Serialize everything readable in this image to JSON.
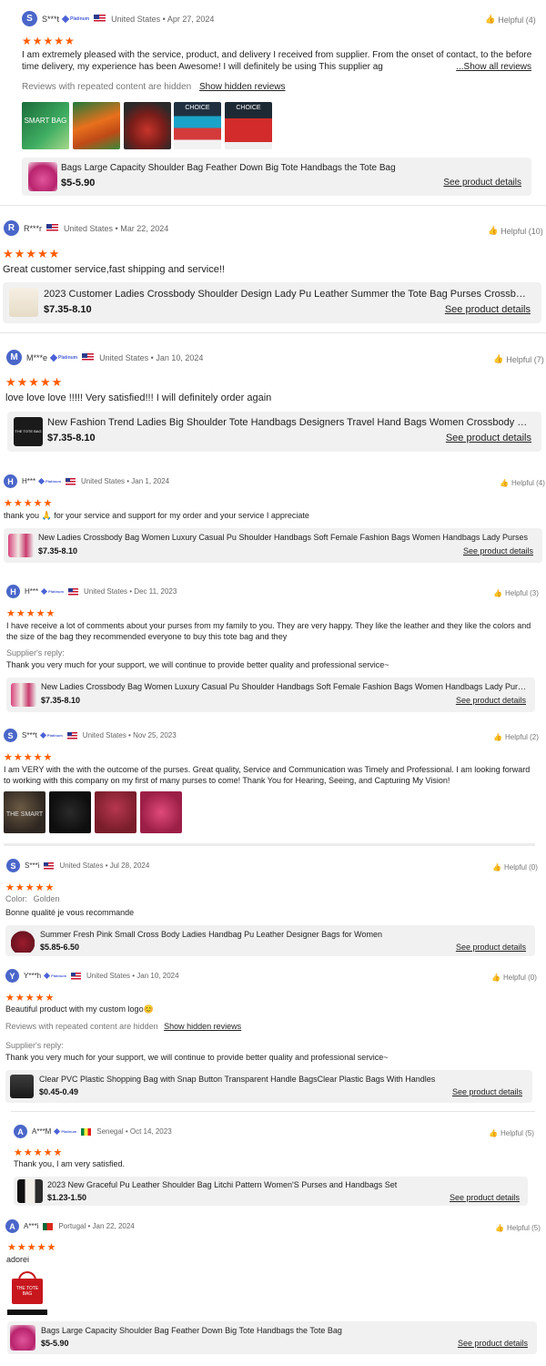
{
  "common": {
    "see_details": "See product details",
    "badge": "Platinum",
    "star_glyphs": "★★★★★",
    "suppliers_reply_label": "Supplier's reply:",
    "hidden_note": "Reviews with repeated content are hidden",
    "show_hidden": "Show hidden reviews",
    "show_all": "...Show all reviews"
  },
  "reviews": [
    {
      "initial": "S",
      "name": "S***t",
      "platinum": true,
      "flag": "us",
      "meta": "United States • Apr 27, 2024",
      "helpful": "Helpful (4)",
      "rating": 5,
      "text": "I am extremely pleased with the service, product, and delivery I received from supplier. From the onset of contact, to the before time delivery, my experience has been Awesome! I will definitely be using This supplier ag",
      "product": {
        "title": "Bags Large Capacity Shoulder Bag Feather Down Big Tote Handbags the Tote Bag",
        "price": "$5-5.90"
      }
    },
    {
      "initial": "R",
      "name": "R***r",
      "platinum": false,
      "flag": "us",
      "meta": "United States • Mar 22, 2024",
      "helpful": "Helpful (10)",
      "rating": 5,
      "text": "Great customer service,fast shipping and service!!",
      "product": {
        "title": "2023 Customer Ladies Crossbody Shoulder Design Lady Pu Leather Summer the Tote Bag Purses Crossbody Bag",
        "price": "$7.35-8.10"
      }
    },
    {
      "initial": "M",
      "name": "M***e",
      "platinum": true,
      "flag": "us",
      "meta": "United States • Jan 10, 2024",
      "helpful": "Helpful (7)",
      "rating": 5,
      "text": "love love love !!!!! Very satisfied!!! I will definitely order again",
      "product": {
        "title": "New Fashion Trend Ladies Big Shoulder Tote Handbags Designers Travel Hand Bags Women Crossbody Bags",
        "price": "$7.35-8.10"
      }
    },
    {
      "initial": "H",
      "name": "H***",
      "platinum": true,
      "flag": "us",
      "meta": "United States • Jan 1, 2024",
      "helpful": "Helpful (4)",
      "rating": 5,
      "text": "thank you 🙏 for your service and support for my order and your service I appreciate",
      "product": {
        "title": "New Ladies Crossbody Bag Women Luxury Casual Pu Shoulder Handbags Soft Female Fashion Bags Women Handbags Lady Purses",
        "price": "$7.35-8.10"
      }
    },
    {
      "initial": "H",
      "name": "H***",
      "platinum": true,
      "flag": "us",
      "meta": "United States • Dec 11, 2023",
      "helpful": "Helpful (3)",
      "rating": 5,
      "text": "I have receive a lot of comments about your purses from my family to you. They are very happy. They like the leather and they like the colors and the size of the bag they recommended everyone to buy this tote bag and they",
      "reply": "Thank you very much for your support, we will continue to provide better quality and professional service~",
      "product": {
        "title": "New Ladies Crossbody Bag Women Luxury Casual Pu Shoulder Handbags Soft Female Fashion Bags Women Handbags Lady Purses",
        "price": "$7.35-8.10"
      }
    },
    {
      "initial": "S",
      "name": "S***t",
      "platinum": true,
      "flag": "us",
      "meta": "United States • Nov 25, 2023",
      "helpful": "Helpful (2)",
      "rating": 5,
      "text": "I am VERY with the with the outcome of the purses. Great quality, Service and Communication was Timely and Professional. I am looking forward to working with this company on my first of many purses to come! Thank You for Hearing, Seeing, and Capturing My Vision!"
    },
    {
      "initial": "S",
      "name": "S***i",
      "platinum": false,
      "flag": "us",
      "meta": "United States • Jul 28, 2024",
      "helpful": "Helpful (0)",
      "rating": 5,
      "color_label": "Color:",
      "color_value": "Golden",
      "text": "Bonne qualité je vous recommande",
      "product": {
        "title": "Summer Fresh Pink Small Cross Body Ladies Handbag Pu Leather Designer Bags for Women",
        "price": "$5.85-6.50"
      }
    },
    {
      "initial": "Y",
      "name": "Y***h",
      "platinum": true,
      "flag": "us",
      "meta": "United States • Jan 10, 2024",
      "helpful": "Helpful (0)",
      "rating": 5,
      "text": "Beautiful product with my custom logo😊",
      "reply": "Thank you very much for your support, we will continue to provide better quality and professional service~",
      "product": {
        "title": "Clear PVC Plastic Shopping Bag with Snap Button Transparent Handle BagsClear Plastic Bags With Handles",
        "price": "$0.45-0.49"
      }
    },
    {
      "initial": "A",
      "name": "A***M",
      "platinum": true,
      "flag": "sn",
      "meta": "Senegal • Oct 14, 2023",
      "helpful": "Helpful (5)",
      "rating": 5,
      "text": "Thank you, I am very satisfied.",
      "product": {
        "title": "2023 New Graceful Pu Leather Shoulder Bag Litchi Pattern Women'S Purses and Handbags Set",
        "price": "$1.23-1.50"
      }
    },
    {
      "initial": "A",
      "name": "A***i",
      "platinum": false,
      "flag": "pt",
      "meta": "Portugal • Jan 22, 2024",
      "helpful": "Helpful (5)",
      "rating": 5,
      "text": "adorei",
      "product": {
        "title": "Bags Large Capacity Shoulder Bag Feather Down Big Tote Handbags the Tote Bag",
        "price": "$5-5.90"
      }
    }
  ],
  "photo_texts": {
    "smart_bag": "SMART BAG",
    "choice": "CHOICE",
    "the_smart": "THE SMART",
    "tote_bag": "THE TOTE BAG"
  }
}
